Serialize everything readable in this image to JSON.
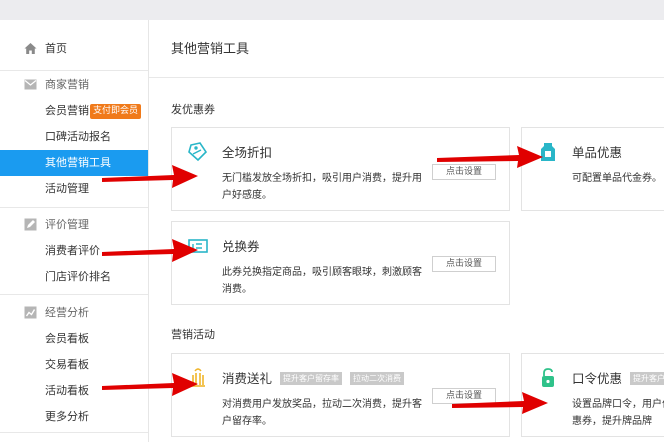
{
  "sidebar": {
    "home": "首页",
    "sections": [
      {
        "title": "商家营销",
        "items": [
          "会员营销",
          "口碑活动报名",
          "其他营销工具",
          "活动管理"
        ],
        "badge": "支付即会员"
      },
      {
        "title": "评价管理",
        "items": [
          "消费者评价",
          "门店评价排名"
        ]
      },
      {
        "title": "经营分析",
        "items": [
          "会员看板",
          "交易看板",
          "活动看板",
          "更多分析"
        ]
      }
    ]
  },
  "main": {
    "title": "其他营销工具",
    "sections": [
      {
        "title": "发优惠券"
      },
      {
        "title": "营销活动"
      }
    ],
    "cards": [
      {
        "title": "全场折扣",
        "desc": "无门槛发放全场折扣，吸引用户消费，提升用户好感度。",
        "button": "点击设置"
      },
      {
        "title": "单品优惠",
        "desc": "可配置单品代金券。"
      },
      {
        "title": "兑换券",
        "desc": "此券兑换指定商品，吸引顾客眼球，刺激顾客消费。",
        "button": "点击设置"
      },
      {
        "title": "消费送礼",
        "tags": [
          "提升客户留存率",
          "拉动二次消费"
        ],
        "desc": "对消费用户发放奖品，拉动二次消费，提升客户留存率。",
        "button": "点击设置"
      },
      {
        "title": "口令优惠",
        "tags": [
          "提升客户"
        ],
        "desc": "设置品牌口令，用户优惠券，提升牌品牌"
      }
    ]
  },
  "colors": {
    "accent": "#1a9bf0",
    "badge": "#f07a1a",
    "icon": "#29b6c8",
    "arrow": "#e00000"
  }
}
